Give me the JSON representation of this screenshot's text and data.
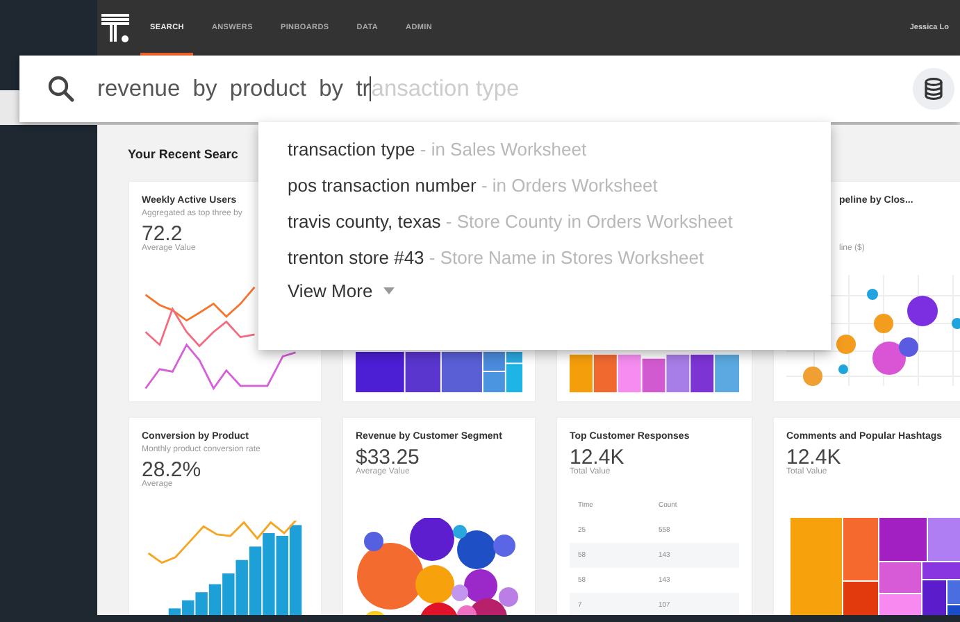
{
  "nav": {
    "tabs": [
      {
        "label": "SEARCH",
        "selected": true
      },
      {
        "label": "ANSWERS",
        "selected": false
      },
      {
        "label": "PINBOARDS",
        "selected": false
      },
      {
        "label": "DATA",
        "selected": false
      },
      {
        "label": "ADMIN",
        "selected": false
      }
    ],
    "user": "Jessica Lo"
  },
  "search": {
    "value": "revenue  by  product  by  tr",
    "completion": "ansaction type"
  },
  "suggestions": {
    "items": [
      {
        "term": "transaction type",
        "source": "- in Sales Worksheet"
      },
      {
        "term": "pos transaction number",
        "source": "- in Orders Worksheet"
      },
      {
        "term": "travis county, texas",
        "source": "- Store County in Orders Worksheet"
      },
      {
        "term": "trenton store #43",
        "source": "- Store Name in Stores Worksheet"
      }
    ],
    "more": "View More"
  },
  "section_title": "Your Recent Searc",
  "cards": [
    {
      "kind": "line",
      "title": "Weekly Active Users",
      "subtitle": "Aggregated as top three by",
      "value": "72.2",
      "value_label": "Average Value"
    },
    {
      "kind": "treemap"
    },
    {
      "kind": "bars"
    },
    {
      "kind": "scatter",
      "title": "peline by Clos...",
      "subtitle": "line ($)"
    },
    {
      "kind": "combo",
      "title": "Conversion by Product",
      "subtitle": "Monthly product conversion rate",
      "value": "28.2%",
      "value_label": "Average"
    },
    {
      "kind": "bubble",
      "title": "Revenue by Customer Segment",
      "value": "$33.25",
      "value_label": "Average Value"
    },
    {
      "kind": "table",
      "title": "Top Customer Responses",
      "value": "12.4K",
      "value_label": "Total Value",
      "table": {
        "columns": [
          "Time",
          "Count"
        ],
        "rows": [
          [
            "25",
            "558"
          ],
          [
            "58",
            "143"
          ],
          [
            "58",
            "143"
          ],
          [
            "7",
            "107"
          ]
        ]
      }
    },
    {
      "kind": "mosaic",
      "title": "Comments and Popular Hashtags",
      "value": "12.4K",
      "value_label": "Total Value"
    }
  ]
}
